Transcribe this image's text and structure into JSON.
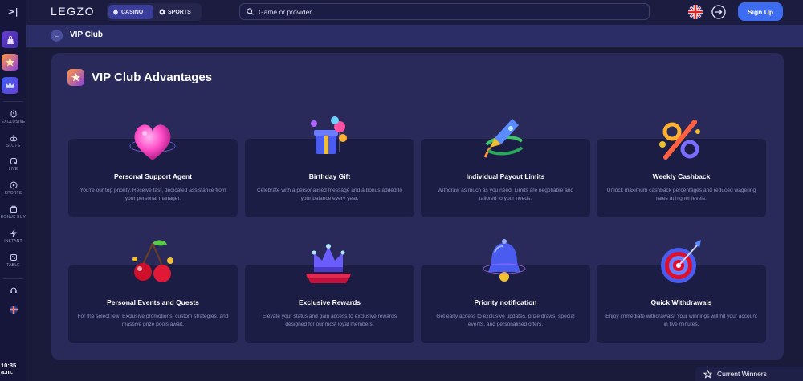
{
  "sidebar": {
    "nav": [
      {
        "label": "EXCLUSIVE"
      },
      {
        "label": "SLOTS"
      },
      {
        "label": "LIVE"
      },
      {
        "label": "SPORTS"
      },
      {
        "label": "BONUS BUY"
      },
      {
        "label": "INSTANT"
      },
      {
        "label": "TABLE"
      }
    ],
    "clock": "10:35 a.m."
  },
  "header": {
    "logo": "LEGZO",
    "casino_label": "CASINO",
    "sports_label": "SPORTS",
    "search_placeholder": "Game or provider",
    "signup_label": "Sign Up"
  },
  "breadcrumb": {
    "title": "VIP Club"
  },
  "panel": {
    "title": "VIP Club Advantages",
    "cards": [
      {
        "title": "Personal Support Agent",
        "desc": "You're our top priority. Receive fast, dedicated assistance from your personal manager.",
        "icon": "heart-icon"
      },
      {
        "title": "Birthday Gift",
        "desc": "Celebrate with a personalised message and a bonus added to your balance every year.",
        "icon": "gift-icon"
      },
      {
        "title": "Individual Payout Limits",
        "desc": "Withdraw as much as you need. Limits are negotiable and tailored to your needs.",
        "icon": "rocket-icon"
      },
      {
        "title": "Weekly Cashback",
        "desc": "Unlock maximum cashback percentages and reduced wagering rates at higher levels.",
        "icon": "percent-icon"
      },
      {
        "title": "Personal Events and Quests",
        "desc": "For the select few: Exclusive promotions, custom strategies, and massive prize pools await.",
        "icon": "cherries-icon"
      },
      {
        "title": "Exclusive Rewards",
        "desc": "Elevate your status and gain access to exclusive rewards designed for our most loyal members.",
        "icon": "crown-icon"
      },
      {
        "title": "Priority notification",
        "desc": "Get early access to exclusive updates, prize draws, special events, and personalised offers.",
        "icon": "bell-icon"
      },
      {
        "title": "Quick Withdrawals",
        "desc": "Enjoy immediate withdrawals! Your winnings will hit your account in five minutes.",
        "icon": "target-icon"
      }
    ]
  },
  "winners": {
    "label": "Current Winners"
  },
  "colors": {
    "accent": "#3d6cf0",
    "background": "#1a1b3a",
    "panel": "#292a5a",
    "card": "#1c1d45"
  }
}
